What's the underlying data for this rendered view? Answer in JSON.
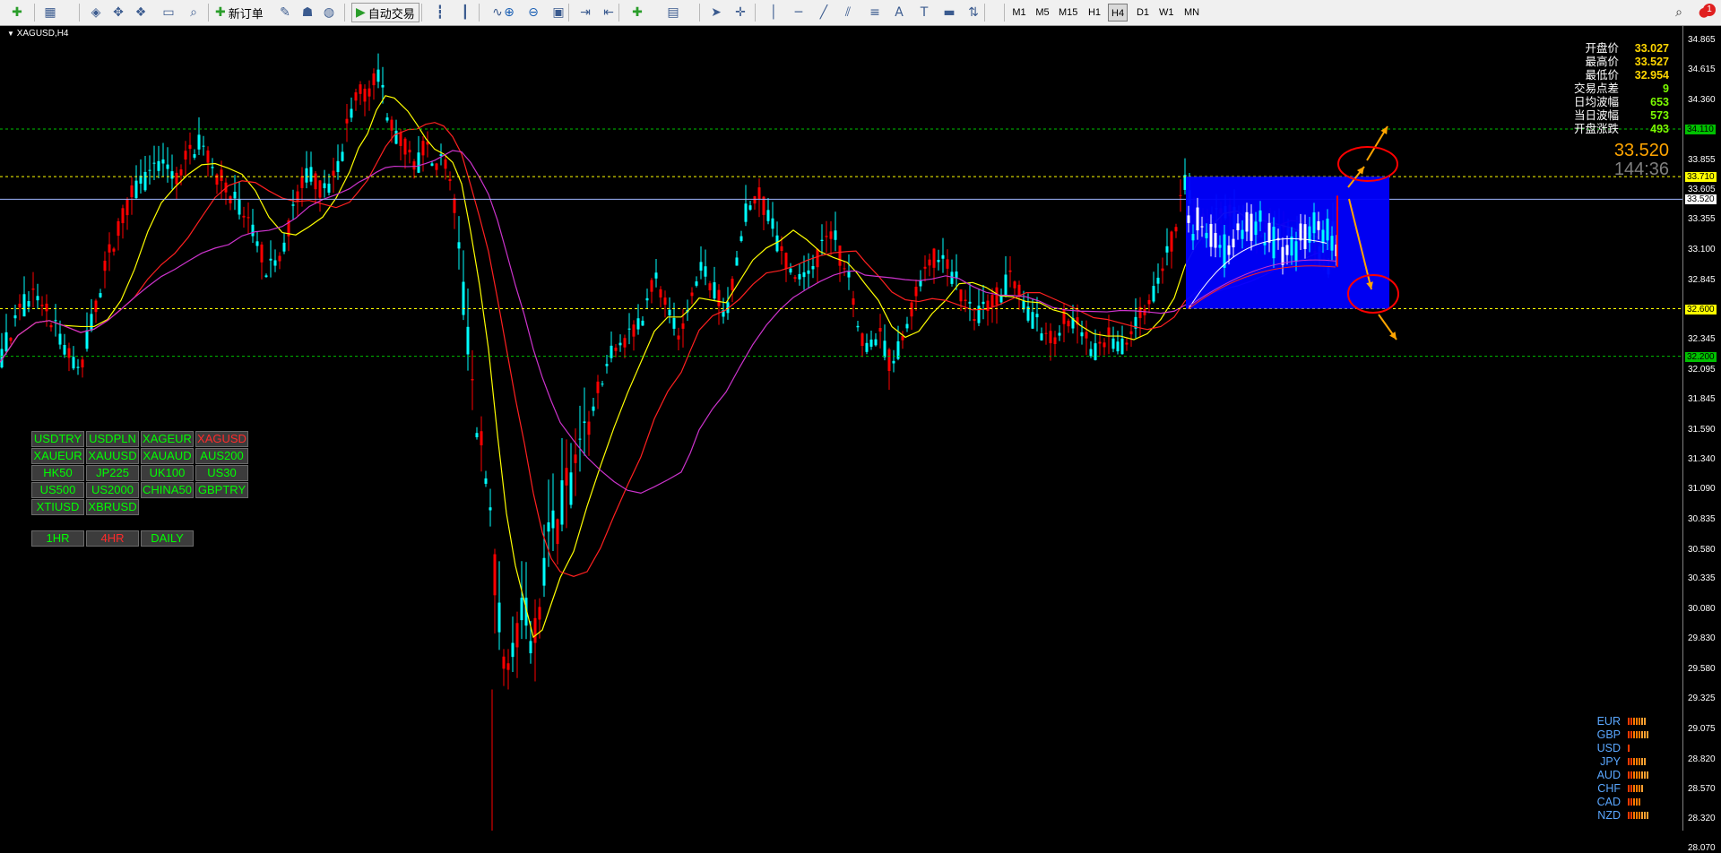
{
  "toolbar": {
    "new_order_label": "新订单",
    "auto_trade_label": "自动交易",
    "timeframes": [
      "M1",
      "M5",
      "M15",
      "H1",
      "H4",
      "D1",
      "W1",
      "MN"
    ],
    "active_timeframe": "H4",
    "icons": [
      "new-chart-icon",
      "profiles-icon",
      "market-watch-icon",
      "navigator-icon",
      "data-window-icon",
      "terminal-icon",
      "strategy-tester-icon",
      "new-order-icon",
      "metaeditor-icon",
      "signals-icon",
      "market-icon",
      "auto-trading-icon",
      "bar-chart-icon",
      "candlestick-icon",
      "line-chart-icon",
      "zoom-in-icon",
      "zoom-out-icon",
      "tile-windows-icon",
      "chart-shift-icon",
      "auto-scroll-icon",
      "indicators-icon",
      "templates-icon",
      "cursor-icon",
      "crosshair-icon",
      "vertical-line-icon",
      "horizontal-line-icon",
      "trendline-icon",
      "channel-icon",
      "fibonacci-icon",
      "text-icon",
      "text-label-icon",
      "rectangle-icon",
      "arrows-icon",
      "search-icon",
      "notification-icon"
    ],
    "notification_count": "1"
  },
  "chart": {
    "symbol_label": "XAGUSD,H4",
    "current_price": "33.520",
    "countdown": "144:36",
    "info": [
      {
        "label": "开盘价",
        "value": "33.027"
      },
      {
        "label": "最高价",
        "value": "33.527"
      },
      {
        "label": "最低价",
        "value": "32.954"
      },
      {
        "label": "交易点差",
        "value": "9"
      },
      {
        "label": "日均波幅",
        "value": "653"
      },
      {
        "label": "当日波幅",
        "value": "573"
      },
      {
        "label": "开盘涨跌",
        "value": "493"
      }
    ],
    "price_axis": [
      "34.865",
      "34.615",
      "34.360",
      "34.110",
      "33.855",
      "33.605",
      "33.355",
      "33.100",
      "32.845",
      "32.600",
      "32.345",
      "32.095",
      "31.845",
      "31.590",
      "31.340",
      "31.090",
      "30.835",
      "30.580",
      "30.335",
      "30.080",
      "29.830",
      "29.580",
      "29.325",
      "29.075",
      "28.820",
      "28.570",
      "28.320",
      "28.070"
    ],
    "axis_tags": [
      {
        "value": "34.110",
        "color": "#00c000"
      },
      {
        "value": "33.710",
        "color": "#ffff00"
      },
      {
        "value": "33.520",
        "color": "#ffffff"
      },
      {
        "value": "32.600",
        "color": "#ffff00"
      },
      {
        "value": "32.200",
        "color": "#00c000"
      }
    ],
    "levels": [
      {
        "price": 34.11,
        "color": "#00c000"
      },
      {
        "price": 33.71,
        "color": "#ffff00"
      },
      {
        "price": 32.6,
        "color": "#ffff00"
      },
      {
        "price": 32.2,
        "color": "#00c000"
      }
    ],
    "colors": {
      "bull": "#00ffff",
      "bear": "#ff0000",
      "ma_fast": "#ffff00",
      "ma_mid": "#ff2020",
      "ma_slow": "#cc33cc",
      "range_box": "#0000ff",
      "arrows": "#ffa500",
      "circles": "#ff0000"
    }
  },
  "symbol_buttons": [
    {
      "label": "USDTRY",
      "color": "green"
    },
    {
      "label": "USDPLN",
      "color": "green"
    },
    {
      "label": "XAGEUR",
      "color": "green"
    },
    {
      "label": "XAGUSD",
      "color": "red"
    },
    {
      "label": "XAUEUR",
      "color": "green"
    },
    {
      "label": "XAUUSD",
      "color": "green"
    },
    {
      "label": "XAUAUD",
      "color": "green"
    },
    {
      "label": "AUS200",
      "color": "green"
    },
    {
      "label": "HK50",
      "color": "green"
    },
    {
      "label": "JP225",
      "color": "green"
    },
    {
      "label": "UK100",
      "color": "green"
    },
    {
      "label": "US30",
      "color": "green"
    },
    {
      "label": "US500",
      "color": "green"
    },
    {
      "label": "US2000",
      "color": "green"
    },
    {
      "label": "CHINA50",
      "color": "green"
    },
    {
      "label": "GBPTRY",
      "color": "green"
    },
    {
      "label": "XTIUSD",
      "color": "green"
    },
    {
      "label": "XBRUSD",
      "color": "green"
    }
  ],
  "timeframe_buttons": [
    {
      "label": "1HR",
      "color": "green"
    },
    {
      "label": "4HR",
      "color": "red"
    },
    {
      "label": "DAILY",
      "color": "green"
    }
  ],
  "currency_strength": [
    {
      "name": "EUR",
      "strength": 7
    },
    {
      "name": "GBP",
      "strength": 8
    },
    {
      "name": "USD",
      "strength": 1
    },
    {
      "name": "JPY",
      "strength": 7
    },
    {
      "name": "AUD",
      "strength": 8
    },
    {
      "name": "CHF",
      "strength": 6
    },
    {
      "name": "CAD",
      "strength": 5
    },
    {
      "name": "NZD",
      "strength": 8
    }
  ]
}
